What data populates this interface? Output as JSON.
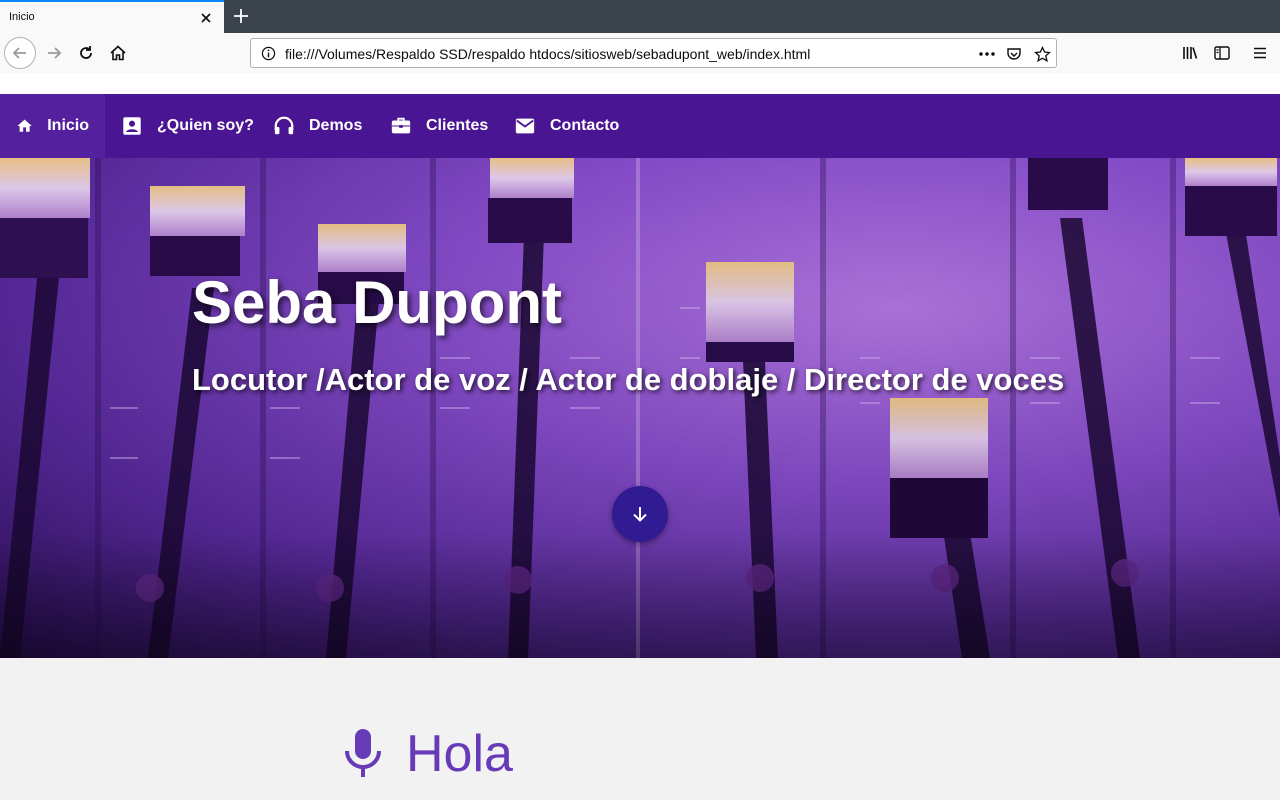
{
  "browser": {
    "tab_title": "Inicio",
    "url": "file:///Volumes/Respaldo SSD/respaldo htdocs/sitiosweb/sebadupont_web/index.html",
    "icons": [
      "back-icon",
      "forward-icon",
      "reload-icon",
      "home-icon",
      "info-icon",
      "more-icon",
      "pocket-icon",
      "bookmark-star-icon",
      "library-icon",
      "sidebar-icon",
      "menu-icon"
    ]
  },
  "nav": {
    "items": [
      {
        "label": "Inicio",
        "icon": "home-icon",
        "active": true
      },
      {
        "label": "¿Quien soy?",
        "icon": "contact-card-icon",
        "active": false
      },
      {
        "label": "Demos",
        "icon": "headphones-icon",
        "active": false
      },
      {
        "label": "Clientes",
        "icon": "briefcase-icon",
        "active": false
      },
      {
        "label": "Contacto",
        "icon": "mail-icon",
        "active": false
      }
    ],
    "color": "#4a1593"
  },
  "hero": {
    "title": "Seba Dupont",
    "subtitle": "Locutor /Actor de voz / Actor de doblaje / Director de voces",
    "scroll_icon": "arrow-down-icon"
  },
  "section": {
    "title": "Hola",
    "icon": "microphone-icon",
    "accent": "#673ab7"
  }
}
